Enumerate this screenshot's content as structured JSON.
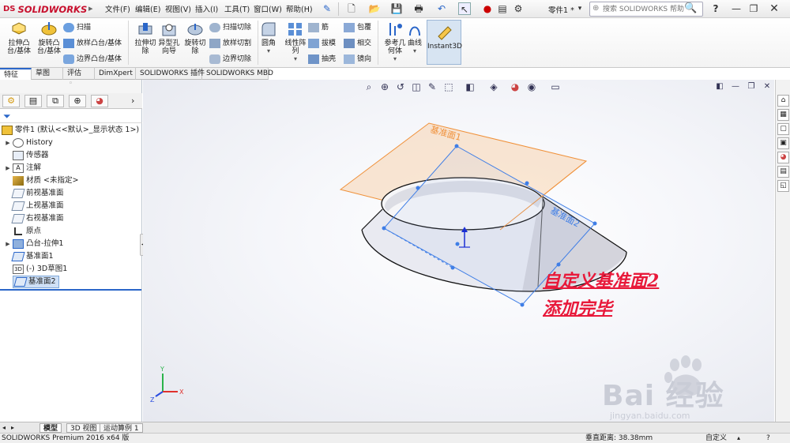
{
  "app": {
    "brand_prefix": "DS",
    "brand": "SOLIDWORKS"
  },
  "menu": [
    "文件(F)",
    "编辑(E)",
    "视图(V)",
    "插入(I)",
    "工具(T)",
    "窗口(W)",
    "帮助(H)"
  ],
  "doc_title": "零件1 *",
  "search": {
    "placeholder": "搜索 SOLIDWORKS 帮助"
  },
  "ribbon": {
    "extrude_boss": "拉伸凸\n台/基体",
    "revolve_boss": "旋转凸\n台/基体",
    "sweep": "扫描",
    "loft_boss": "放样凸台/基体",
    "boundary_boss": "边界凸台/基体",
    "extrude_cut": "拉伸切\n除",
    "hole_wizard": "异型孔\n向导",
    "revolve_cut": "旋转切\n除",
    "sweep_cut": "扫描切除",
    "loft_cut": "放样切割",
    "boundary_cut": "边界切除",
    "fillet": "圆角",
    "linear_pattern": "线性阵\n列",
    "rib": "筋",
    "draft": "拔模",
    "shell": "抽壳",
    "wrap": "包覆",
    "intersect": "相交",
    "mirror": "镜向",
    "ref_geometry": "参考几\n何体",
    "curves": "曲线",
    "instant3d": "Instant3D"
  },
  "tabs": [
    "特征",
    "草图",
    "评估",
    "DimXpert",
    "SOLIDWORKS 插件",
    "SOLIDWORKS MBD"
  ],
  "tree": {
    "root": "零件1 (默认<<默认>_显示状态 1>)",
    "items": [
      "History",
      "传感器",
      "注解",
      "材质 <未指定>",
      "前视基准面",
      "上视基准面",
      "右视基准面",
      "原点",
      "凸台-拉伸1",
      "基准面1",
      "(-) 3D草图1",
      "基准面2"
    ]
  },
  "viewport": {
    "plane1_label": "基准面1",
    "plane2_label": "基准面2",
    "annotation_line1": "自定义基准面2",
    "annotation_line2": "添加完毕",
    "triad_x": "X",
    "triad_y": "Y",
    "triad_z": "Z"
  },
  "watermark": {
    "text": "Bai 经验",
    "url": "jingyan.baidu.com"
  },
  "bottom_tabs": [
    "模型",
    "3D 视图",
    "运动算例 1"
  ],
  "status": {
    "product": "SOLIDWORKS Premium 2016 x64 版",
    "distance": "垂直距离: 38.38mm",
    "units": "自定义"
  }
}
